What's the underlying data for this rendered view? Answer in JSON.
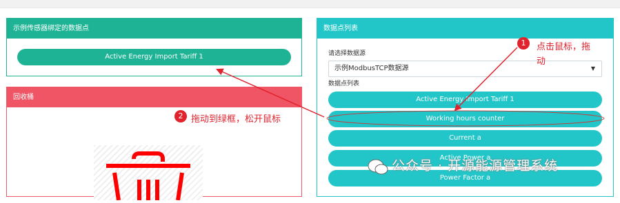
{
  "bound_panel": {
    "title": "示例传感器绑定的数据点",
    "item": "Active Energy Import Tariff 1"
  },
  "trash_panel": {
    "title": "回收桶"
  },
  "points_panel": {
    "title": "数据点列表",
    "source_label": "请选择数据源",
    "source_value": "示例ModbusTCP数据源",
    "list_label": "数据点列表",
    "items": [
      "Active Energy Import Tariff 1",
      "Working hours counter",
      "Current a",
      "Active Power a",
      "Power Factor a"
    ]
  },
  "annotations": {
    "step1_number": "1",
    "step1_text": "点击鼠标，拖",
    "step1_text2": "动",
    "step2_number": "2",
    "step2_text": "拖动到绿框，松开鼠标"
  },
  "watermark": "公众号 · 开源能源管理系统",
  "colors": {
    "green": "#1db394",
    "red": "#ef5564",
    "cyan": "#23c6c8",
    "annotation": "#e1232d"
  }
}
